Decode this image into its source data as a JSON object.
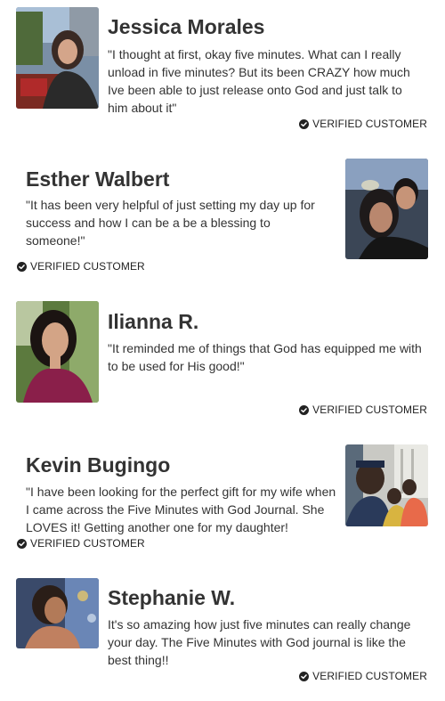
{
  "reviews": [
    {
      "name": "Jessica Morales",
      "quote": "\"I thought at first, okay five minutes. What can I really unload in five minutes? But its been CRAZY how much Ive been able to just release onto God and just talk to him about it\"",
      "badge": "VERIFIED CUSTOMER",
      "photo_icon": "woman-portrait-photo"
    },
    {
      "name": "Esther Walbert",
      "quote": "\"It has been very helpful of just setting my day up for success and how I can be a be a blessing to someone!\"",
      "badge": "VERIFIED CUSTOMER",
      "photo_icon": "couple-selfie-photo"
    },
    {
      "name": "Ilianna R.",
      "quote": "\"It reminded me of things that God has equipped me with to be used for His good!\"",
      "badge": "VERIFIED CUSTOMER",
      "photo_icon": "woman-selfie-photo"
    },
    {
      "name": "Kevin Bugingo",
      "quote": "\"I have been looking for the perfect gift for my wife when I came across the Five Minutes with God Journal. She LOVES it! Getting another one for my daughter!",
      "badge": "VERIFIED CUSTOMER",
      "photo_icon": "family-photo"
    },
    {
      "name": "Stephanie W.",
      "quote": "It's so amazing how just five minutes can really change your day. The Five Minutes with God journal is like the best thing!!",
      "badge": "VERIFIED CUSTOMER",
      "photo_icon": "woman-profile-photo"
    }
  ],
  "colors": {
    "text": "#333333",
    "badge_text": "#222222",
    "background": "#ffffff"
  }
}
